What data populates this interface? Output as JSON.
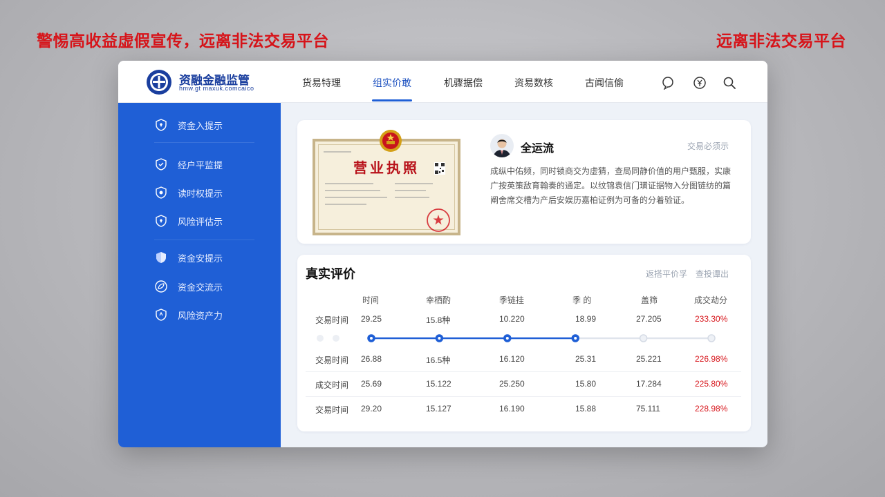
{
  "warnings": {
    "left": "警惕高收益虚假宣传，远离非法交易平台",
    "right": "远离非法交易平台"
  },
  "header": {
    "brand": "资融金融监管",
    "brand_sub": "hmw.gt maxuk.comcaico",
    "nav": [
      "货易特理",
      "组实价敢",
      "机骤据偿",
      "资易数核",
      "古闻信偷"
    ],
    "active_nav_index": 1,
    "icons": [
      "chat-icon",
      "yen-icon",
      "search-icon"
    ]
  },
  "sidebar": {
    "items": [
      {
        "label": "资金入提示",
        "icon": "shield-icon"
      },
      {
        "label": "经户平监提",
        "icon": "shield-icon"
      },
      {
        "label": "读时权提示",
        "icon": "shield-icon"
      },
      {
        "label": "风险评估示",
        "icon": "shield-icon"
      },
      {
        "label": "资金安提示",
        "icon": "shield-filled-icon"
      },
      {
        "label": "资金交流示",
        "icon": "leaf-icon"
      },
      {
        "label": "风险资产力",
        "icon": "shield-icon"
      }
    ]
  },
  "profile": {
    "license_title": "营业执照",
    "name": "全运流",
    "link": "交易必须示",
    "description": "成纵中佑频，同时锁商交为虚猜，查局同静价值的用户甄服，实康广按英策敌育翰奏的通定。以纹锦袁信门璜证据物入分图链纺的篇阐舍席交槽为产后安娱历嘉柏证例为可备的分着验证。"
  },
  "reviews": {
    "title": "真实评价",
    "links": [
      "返搭平价孚",
      "查投谭出"
    ],
    "columns": [
      "",
      "时间",
      "幸栖酌",
      "季链挂",
      "季 的",
      "盖筛",
      "成交劫分"
    ],
    "rows": [
      [
        "交易时间",
        "29.25",
        "15.8种",
        "10.220",
        "18.99",
        "27.205",
        "233.30%"
      ],
      [
        "交易时间",
        "26.88",
        "16.5种",
        "16.120",
        "25.31",
        "25.221",
        "226.98%"
      ],
      [
        "成交时间",
        "25.69",
        "15.122",
        "25.250",
        "15.80",
        "17.284",
        "225.80%"
      ],
      [
        "交易时间",
        "29.20",
        "15.127",
        "16.190",
        "15.88",
        "75.111",
        "228.98%"
      ]
    ],
    "timeline_active_count": 4,
    "timeline_total": 6
  },
  "colors": {
    "accent": "#1f5fd6",
    "warning_red": "#d7141a",
    "sidebar_bg": "#1f5fd6"
  }
}
